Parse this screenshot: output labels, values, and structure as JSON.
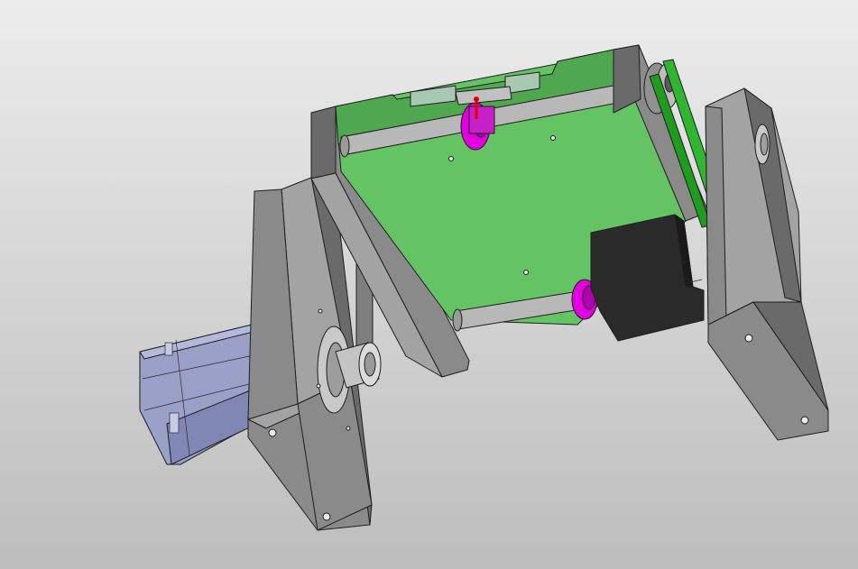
{
  "viewport": {
    "background_top": "#ececec",
    "background_bottom": "#bdbdbd"
  },
  "colors": {
    "plate": "#64c464",
    "plate_shade": "#4fa84f",
    "frame": "#8a8a8a",
    "frame_light": "#a3a3a3",
    "frame_dark": "#6a6a6a",
    "rail": "#b8b8b8",
    "bearing": "#e000e0",
    "motor": "#9aa0c8",
    "belt": "#2fb52f",
    "stepper_black": "#2a2a2a",
    "marker": "#e00000"
  },
  "model": {
    "parts": [
      "left-upright",
      "right-upright",
      "left-motor",
      "green-carriage-plate",
      "rear-linear-rail",
      "front-linear-rail",
      "rear-bearing-block",
      "front-bearing-block",
      "black-stepper-bracket",
      "timing-belt",
      "timing-pulley",
      "belt-idler-assembly",
      "center-pin-marker"
    ]
  }
}
